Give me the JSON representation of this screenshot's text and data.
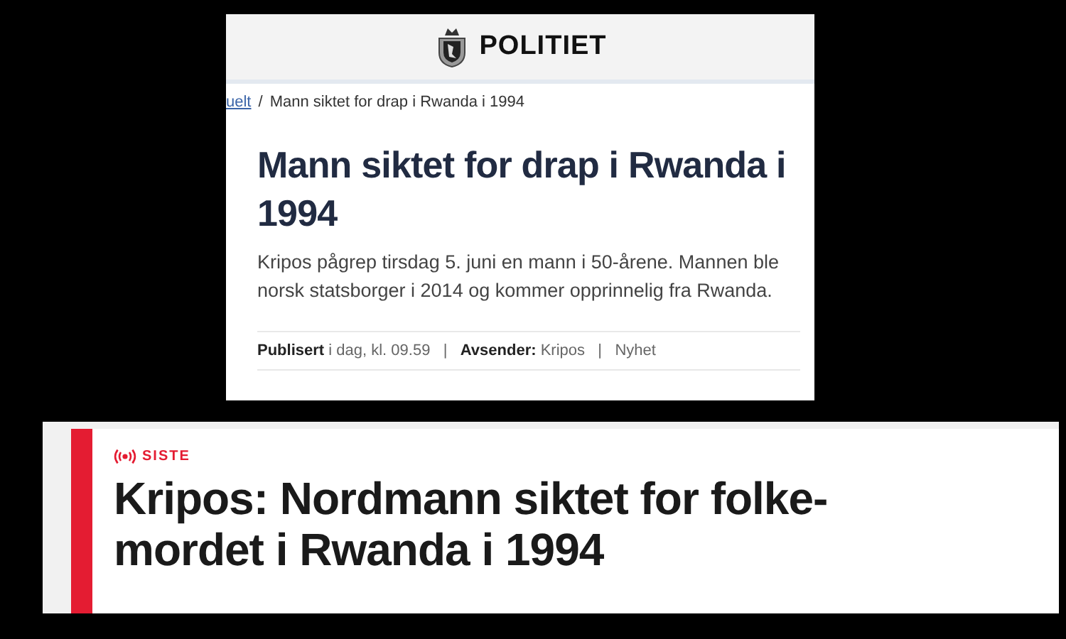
{
  "article": {
    "site_name": "POLITIET",
    "breadcrumb": {
      "link": "uelt",
      "separator": "/",
      "current": "Mann siktet for drap i Rwanda i 1994"
    },
    "headline_lines": [
      "Mann siktet for drap i Rwanda i",
      "1994"
    ],
    "lead_lines": [
      "Kripos pågrep tirsdag 5. juni en mann i 50-årene. Mannen ble",
      "norsk statsborger i 2014 og kommer opprinnelig fra Rwanda."
    ],
    "meta": "**Publisert** i dag, kl. 09.59   |   **Avsender:** Kripos   |   Nyhet"
  },
  "news_banner": {
    "label": "SISTE",
    "headline_lines": [
      "Kripos: Nordmann siktet for folke-",
      "mordet i Rwanda i 1994"
    ]
  }
}
